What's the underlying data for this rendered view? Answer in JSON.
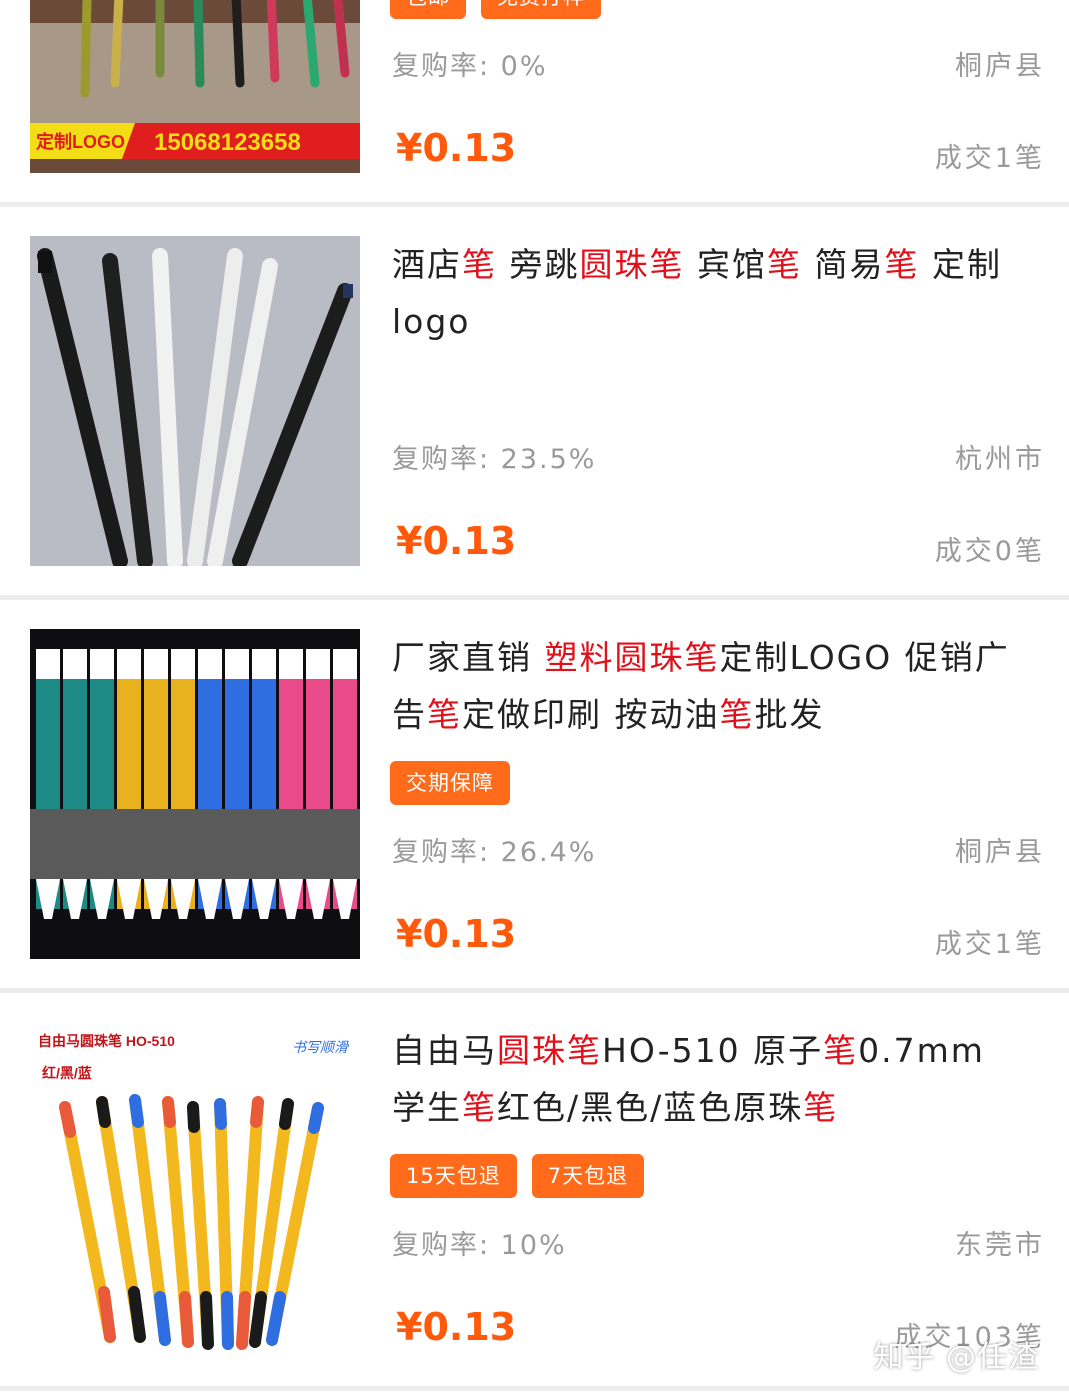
{
  "items": [
    {
      "tags": [
        "包邮",
        "免费打样"
      ],
      "repurchase": "复购率: 0%",
      "location": "桐庐县",
      "price": "¥0.13",
      "deals": "成交1笔",
      "image_banner_left": "定制LOGO",
      "image_banner_right": "15068123658"
    },
    {
      "title_parts": [
        {
          "text": "酒店",
          "hl": false
        },
        {
          "text": "笔",
          "hl": true
        },
        {
          "text": " 旁跳",
          "hl": false
        },
        {
          "text": "圆珠笔",
          "hl": true
        },
        {
          "text": " 宾馆",
          "hl": false
        },
        {
          "text": "笔",
          "hl": true
        },
        {
          "text": " 简易",
          "hl": false
        },
        {
          "text": "笔",
          "hl": true
        },
        {
          "text": " 定制logo",
          "hl": false
        }
      ],
      "repurchase": "复购率: 23.5%",
      "location": "杭州市",
      "price": "¥0.13",
      "deals": "成交0笔"
    },
    {
      "title_parts": [
        {
          "text": "厂家直销 ",
          "hl": false
        },
        {
          "text": "塑料圆珠笔",
          "hl": true
        },
        {
          "text": "定制LOGO 促销广告",
          "hl": false
        },
        {
          "text": "笔",
          "hl": true
        },
        {
          "text": "定做印刷 按动油",
          "hl": false
        },
        {
          "text": "笔",
          "hl": true
        },
        {
          "text": "批发",
          "hl": false
        }
      ],
      "tags": [
        "交期保障"
      ],
      "repurchase": "复购率: 26.4%",
      "location": "桐庐县",
      "price": "¥0.13",
      "deals": "成交1笔"
    },
    {
      "title_parts": [
        {
          "text": "自由马",
          "hl": false
        },
        {
          "text": "圆珠笔",
          "hl": true
        },
        {
          "text": "HO-510 原子",
          "hl": false
        },
        {
          "text": "笔",
          "hl": true
        },
        {
          "text": "0.7mm 学生",
          "hl": false
        },
        {
          "text": "笔",
          "hl": true
        },
        {
          "text": "红色/黑色/蓝色原珠",
          "hl": false
        },
        {
          "text": "笔",
          "hl": true
        }
      ],
      "tags": [
        "15天包退",
        "7天包退"
      ],
      "repurchase": "复购率: 10%",
      "location": "东莞市",
      "price": "¥0.13",
      "deals": "成交103笔",
      "image_label_1": "自由马圆珠笔 HO-510",
      "image_label_2": "红/黑/蓝",
      "image_label_3": "书写顺滑"
    }
  ],
  "watermark": "知乎 @任渣",
  "colors": {
    "price": "#ff5a0c",
    "tag_bg": "#ff6a1b",
    "highlight": "#e0111b",
    "muted": "#9a9a9a"
  }
}
